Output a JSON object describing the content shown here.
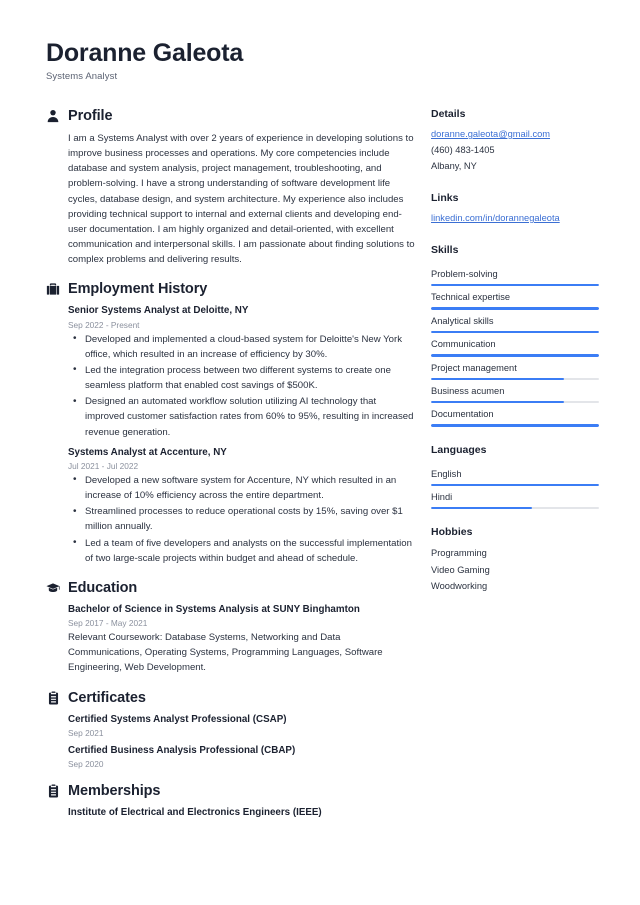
{
  "header": {
    "name": "Doranne Galeota",
    "title": "Systems Analyst"
  },
  "colors": {
    "accent": "#3b7df5",
    "link": "#3b6fd4",
    "text": "#2b3240",
    "heading": "#1b2130",
    "muted": "#8b919e",
    "track": "#e3e5e9"
  },
  "main": {
    "profile": {
      "icon": "person-icon",
      "heading": "Profile",
      "text": "I am a Systems Analyst with over 2 years of experience in developing solutions to improve business processes and operations. My core competencies include database and system analysis, project management, troubleshooting, and problem-solving. I have a strong understanding of software development life cycles, database design, and system architecture. My experience also includes providing technical support to internal and external clients and developing end-user documentation. I am highly organized and detail-oriented, with excellent communication and interpersonal skills. I am passionate about finding solutions to complex problems and delivering results."
    },
    "employment": {
      "icon": "briefcase-icon",
      "heading": "Employment History",
      "entries": [
        {
          "title": "Senior Systems Analyst at Deloitte, NY",
          "date": "Sep 2022 - Present",
          "bullets": [
            "Developed and implemented a cloud-based system for Deloitte's New York office, which resulted in an increase of efficiency by 30%.",
            "Led the integration process between two different systems to create one seamless platform that enabled cost savings of $500K.",
            "Designed an automated workflow solution utilizing AI technology that improved customer satisfaction rates from 60% to 95%, resulting in increased revenue generation."
          ]
        },
        {
          "title": "Systems Analyst at Accenture, NY",
          "date": "Jul 2021 - Jul 2022",
          "bullets": [
            "Developed a new software system for Accenture, NY which resulted in an increase of 10% efficiency across the entire department.",
            "Streamlined processes to reduce operational costs by 15%, saving over $1 million annually.",
            "Led a team of five developers and analysts on the successful implementation of two large-scale projects within budget and ahead of schedule."
          ]
        }
      ]
    },
    "education": {
      "icon": "graduation-cap-icon",
      "heading": "Education",
      "entries": [
        {
          "title": "Bachelor of Science in Systems Analysis at SUNY Binghamton",
          "date": "Sep 2017 - May 2021",
          "text": "Relevant Coursework: Database Systems, Networking and Data Communications, Operating Systems, Programming Languages, Software Engineering, Web Development."
        }
      ]
    },
    "certificates": {
      "icon": "clipboard-icon",
      "heading": "Certificates",
      "entries": [
        {
          "title": "Certified Systems Analyst Professional (CSAP)",
          "date": "Sep 2021"
        },
        {
          "title": "Certified Business Analysis Professional (CBAP)",
          "date": "Sep 2020"
        }
      ]
    },
    "memberships": {
      "icon": "clipboard-icon",
      "heading": "Memberships",
      "entries": [
        {
          "title": "Institute of Electrical and Electronics Engineers (IEEE)"
        }
      ]
    }
  },
  "sidebar": {
    "details": {
      "heading": "Details",
      "email": "doranne.galeota@gmail.com",
      "phone": "(460) 483-1405",
      "location": "Albany, NY"
    },
    "links": {
      "heading": "Links",
      "items": [
        {
          "label": "linkedin.com/in/dorannegaleota"
        }
      ]
    },
    "skills": {
      "heading": "Skills",
      "items": [
        {
          "label": "Problem-solving",
          "level": 100
        },
        {
          "label": "Technical expertise",
          "level": 100
        },
        {
          "label": "Analytical skills",
          "level": 100
        },
        {
          "label": "Communication",
          "level": 100
        },
        {
          "label": "Project management",
          "level": 79
        },
        {
          "label": "Business acumen",
          "level": 79
        },
        {
          "label": "Documentation",
          "level": 100
        }
      ]
    },
    "languages": {
      "heading": "Languages",
      "items": [
        {
          "label": "English",
          "level": 100
        },
        {
          "label": "Hindi",
          "level": 60
        }
      ]
    },
    "hobbies": {
      "heading": "Hobbies",
      "items": [
        {
          "label": "Programming"
        },
        {
          "label": "Video Gaming"
        },
        {
          "label": "Woodworking"
        }
      ]
    }
  }
}
